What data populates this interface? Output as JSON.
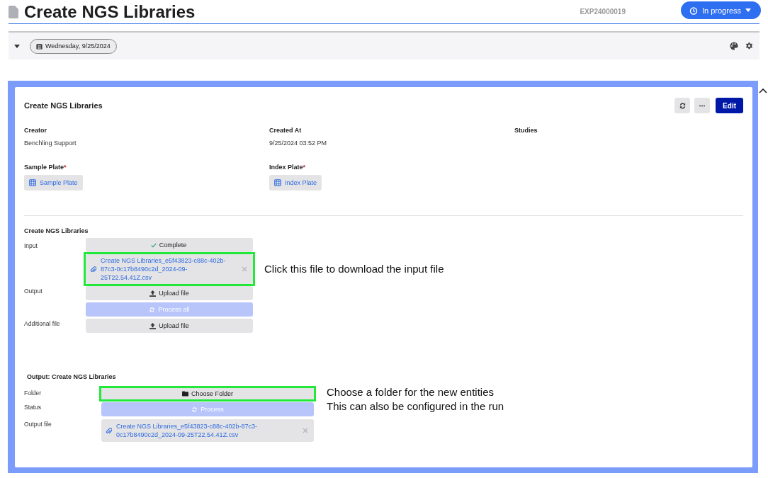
{
  "header": {
    "title": "Create NGS Libraries",
    "experiment_id": "EXP24000019",
    "status": "In progress"
  },
  "toolbar": {
    "expanded": true,
    "date": "Wednesday, 9/25/2024"
  },
  "card": {
    "title": "Create NGS Libraries",
    "edit_button": "Edit",
    "fields": [
      {
        "label": "Creator",
        "value": "Benchling Support"
      },
      {
        "label": "Created At",
        "value": "9/25/2024 03:52 PM"
      },
      {
        "label": "Studies"
      }
    ],
    "entity_fields": [
      {
        "label": "Sample Plate",
        "required_mark": "*",
        "value": "Sample Plate"
      },
      {
        "label": "Index Plate",
        "required_mark": "*",
        "value": "Index Plate"
      }
    ]
  },
  "sections": [
    {
      "title": "Create NGS Libraries",
      "wide": false,
      "items": [
        {
          "label": "Input",
          "kind": "status",
          "text": "Complete",
          "disabled": false,
          "highlighted": false
        },
        {
          "kind": "file",
          "text": "Create NGS Libraries_e5f43823-c88c-402b-87c3-0c17b8490c2d_2024-09-25T22.54.41Z.csv",
          "disabled": false,
          "highlighted": true,
          "note": [
            "Click this file to download the input file"
          ]
        },
        {
          "label": "Output",
          "kind": "upload",
          "text": "Upload file",
          "disabled": false,
          "highlighted": false
        },
        {
          "kind": "process",
          "text": "Process all",
          "disabled": true,
          "highlighted": false
        },
        {
          "label": "Additional file",
          "kind": "upload",
          "text": "Upload file",
          "disabled": false,
          "highlighted": false
        }
      ]
    },
    {
      "title": "Output: Create NGS Libraries",
      "wide": true,
      "items": [
        {
          "label": "Folder",
          "kind": "folder",
          "text": "Choose Folder",
          "disabled": false,
          "highlighted": true,
          "note": [
            "Choose a folder for the new entities",
            "This can also be configured in the run"
          ]
        },
        {
          "label": "Status",
          "kind": "process",
          "text": "Process",
          "disabled": true,
          "highlighted": false
        },
        {
          "label": "Output file",
          "kind": "file",
          "text": "Create NGS Libraries_e5f43823-c88c-402b-87c3-0c17b8490c2d_2024-09-25T22.54.41Z.csv",
          "disabled": false,
          "highlighted": false
        }
      ]
    }
  ]
}
